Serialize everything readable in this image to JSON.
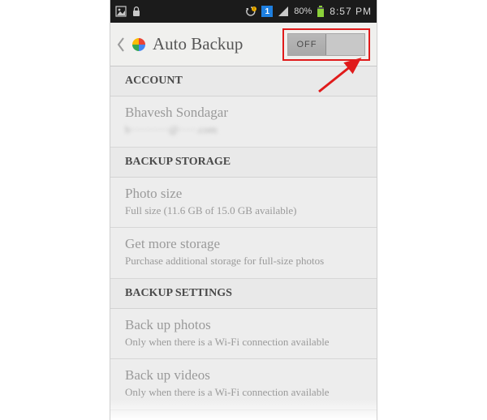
{
  "status": {
    "battery_pct": "80%",
    "time": "8:57 PM",
    "sim_label": "1"
  },
  "header": {
    "title": "Auto Backup",
    "toggle_state": "OFF"
  },
  "sections": {
    "account": {
      "header": "ACCOUNT",
      "name": "Bhavesh Sondagar",
      "email_masked": "b···········@·····.com"
    },
    "storage": {
      "header": "BACKUP STORAGE",
      "photo_size_title": "Photo size",
      "photo_size_sub": "Full size (11.6 GB of 15.0 GB available)",
      "more_title": "Get more storage",
      "more_sub": "Purchase additional storage for full-size photos"
    },
    "settings": {
      "header": "BACKUP SETTINGS",
      "photos_title": "Back up photos",
      "photos_sub": "Only when there is a Wi-Fi connection available",
      "videos_title": "Back up videos",
      "videos_sub": "Only when there is a Wi-Fi connection available"
    }
  },
  "annotation": {
    "color": "#e01b1b"
  }
}
